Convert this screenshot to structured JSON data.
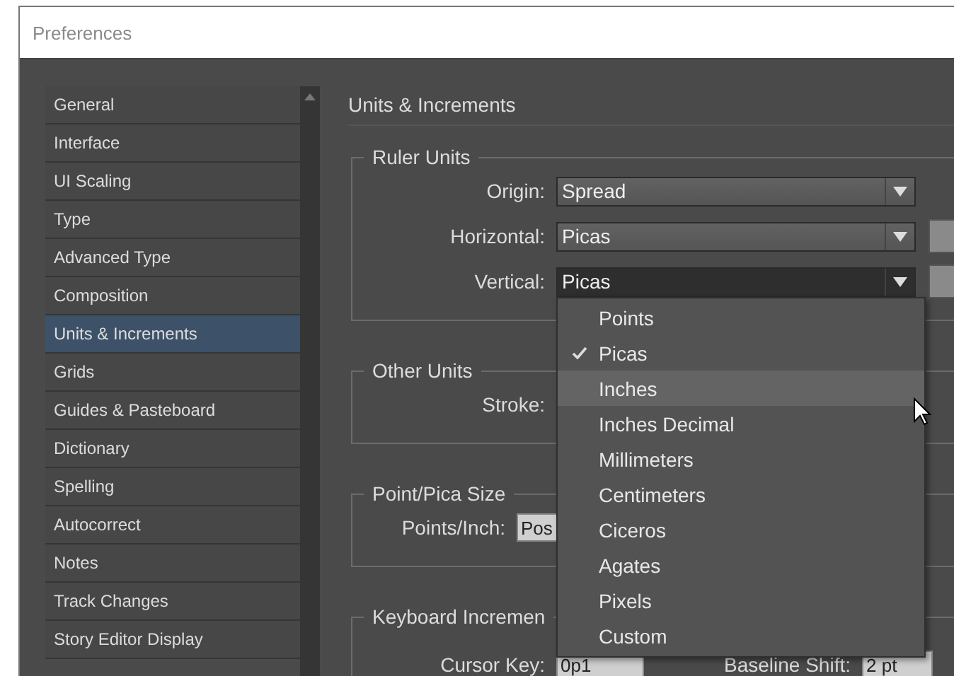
{
  "window": {
    "title": "Preferences"
  },
  "sidebar": {
    "items": [
      {
        "label": "General",
        "selected": false
      },
      {
        "label": "Interface",
        "selected": false
      },
      {
        "label": "UI Scaling",
        "selected": false
      },
      {
        "label": "Type",
        "selected": false
      },
      {
        "label": "Advanced Type",
        "selected": false
      },
      {
        "label": "Composition",
        "selected": false
      },
      {
        "label": "Units & Increments",
        "selected": true
      },
      {
        "label": "Grids",
        "selected": false
      },
      {
        "label": "Guides & Pasteboard",
        "selected": false
      },
      {
        "label": "Dictionary",
        "selected": false
      },
      {
        "label": "Spelling",
        "selected": false
      },
      {
        "label": "Autocorrect",
        "selected": false
      },
      {
        "label": "Notes",
        "selected": false
      },
      {
        "label": "Track Changes",
        "selected": false
      },
      {
        "label": "Story Editor Display",
        "selected": false
      }
    ]
  },
  "panel": {
    "title": "Units & Increments",
    "ruler_units": {
      "legend": "Ruler Units",
      "fields": [
        {
          "label": "Origin:",
          "value": "Spread",
          "open": false,
          "side_box": false
        },
        {
          "label": "Horizontal:",
          "value": "Picas",
          "open": false,
          "side_box": true
        },
        {
          "label": "Vertical:",
          "value": "Picas",
          "open": true,
          "side_box": true
        }
      ]
    },
    "other_units": {
      "legend": "Other Units",
      "label": "Stroke:"
    },
    "point_pica_size": {
      "legend": "Point/Pica Size",
      "label": "Points/Inch:",
      "value": "Pos"
    },
    "keyboard_increments": {
      "legend": "Keyboard Incremen",
      "fields": [
        {
          "label": "Cursor Key:",
          "value": "0p1"
        },
        {
          "label": "Baseline Shift:",
          "value": "2 pt"
        }
      ]
    }
  },
  "dropdown_menu": {
    "items": [
      {
        "label": "Points",
        "checked": false,
        "highlighted": false
      },
      {
        "label": "Picas",
        "checked": true,
        "highlighted": false
      },
      {
        "label": "Inches",
        "checked": false,
        "highlighted": true
      },
      {
        "label": "Inches Decimal",
        "checked": false,
        "highlighted": false
      },
      {
        "label": "Millimeters",
        "checked": false,
        "highlighted": false
      },
      {
        "label": "Centimeters",
        "checked": false,
        "highlighted": false
      },
      {
        "label": "Ciceros",
        "checked": false,
        "highlighted": false
      },
      {
        "label": "Agates",
        "checked": false,
        "highlighted": false
      },
      {
        "label": "Pixels",
        "checked": false,
        "highlighted": false
      },
      {
        "label": "Custom",
        "checked": false,
        "highlighted": false
      }
    ]
  }
}
